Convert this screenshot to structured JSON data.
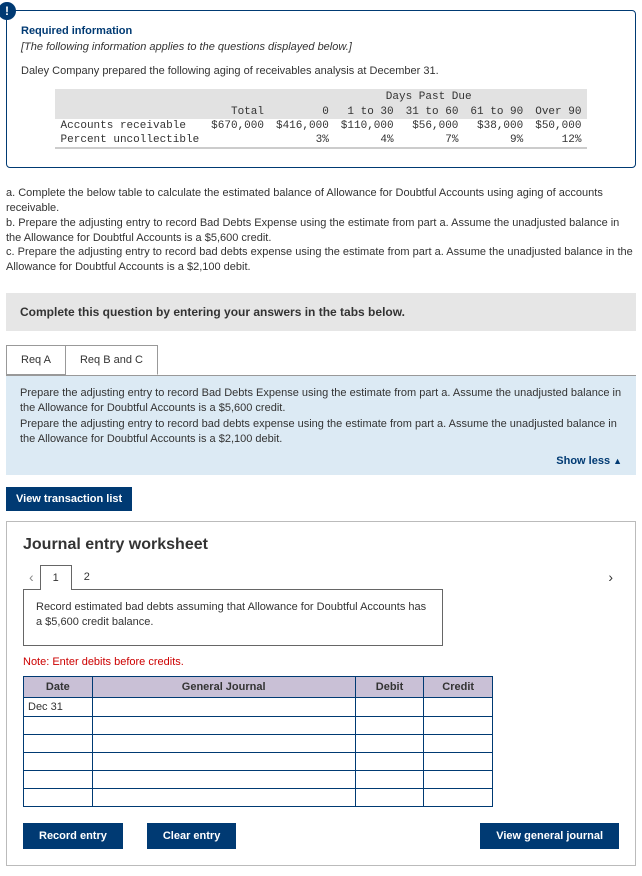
{
  "info_badge": "!",
  "req_info_title": "Required information",
  "req_info_italic": "[The following information applies to the questions displayed below.]",
  "intro": "Daley Company prepared the following aging of receivables analysis at December 31.",
  "aging": {
    "header_span": "Days Past Due",
    "cols": [
      "",
      "Total",
      "0",
      "1 to 30",
      "31 to 60",
      "61 to 90",
      "Over 90"
    ],
    "rows": [
      {
        "label": "Accounts receivable",
        "vals": [
          "$670,000",
          "$416,000",
          "$110,000",
          "$56,000",
          "$38,000",
          "$50,000"
        ]
      },
      {
        "label": "Percent uncollectible",
        "vals": [
          "",
          "3%",
          "4%",
          "7%",
          "9%",
          "12%"
        ]
      }
    ]
  },
  "questions": {
    "a": "a. Complete the below table to calculate the estimated balance of Allowance for Doubtful Accounts using aging of accounts receivable.",
    "b": "b. Prepare the adjusting entry to record Bad Debts Expense using the estimate from part a. Assume the unadjusted balance in the Allowance for Doubtful Accounts is a $5,600 credit.",
    "c": "c. Prepare the adjusting entry to record bad debts expense using the estimate from part a. Assume the unadjusted balance in the Allowance for Doubtful Accounts is a $2,100 debit."
  },
  "gray_bar": "Complete this question by entering your answers in the tabs below.",
  "tabs": {
    "a": "Req A",
    "bc": "Req B and C"
  },
  "blue_panel_1": "Prepare the adjusting entry to record Bad Debts Expense using the estimate from part a. Assume the unadjusted balance in the Allowance for Doubtful Accounts is a $5,600 credit.",
  "blue_panel_2": "Prepare the adjusting entry to record bad debts expense using the estimate from part a. Assume the unadjusted balance in the Allowance for Doubtful Accounts is a $2,100 debit.",
  "show_less": "Show less",
  "view_trans": "View transaction list",
  "ws_title": "Journal entry worksheet",
  "ws_tabs": {
    "t1": "1",
    "t2": "2"
  },
  "ws_desc": "Record estimated bad debts assuming that Allowance for Doubtful Accounts has a $5,600 credit balance.",
  "note": "Note: Enter debits before credits.",
  "je_headers": {
    "date": "Date",
    "gj": "General Journal",
    "debit": "Debit",
    "credit": "Credit"
  },
  "je_date": "Dec 31",
  "buttons": {
    "record": "Record entry",
    "clear": "Clear entry",
    "view": "View general journal"
  }
}
